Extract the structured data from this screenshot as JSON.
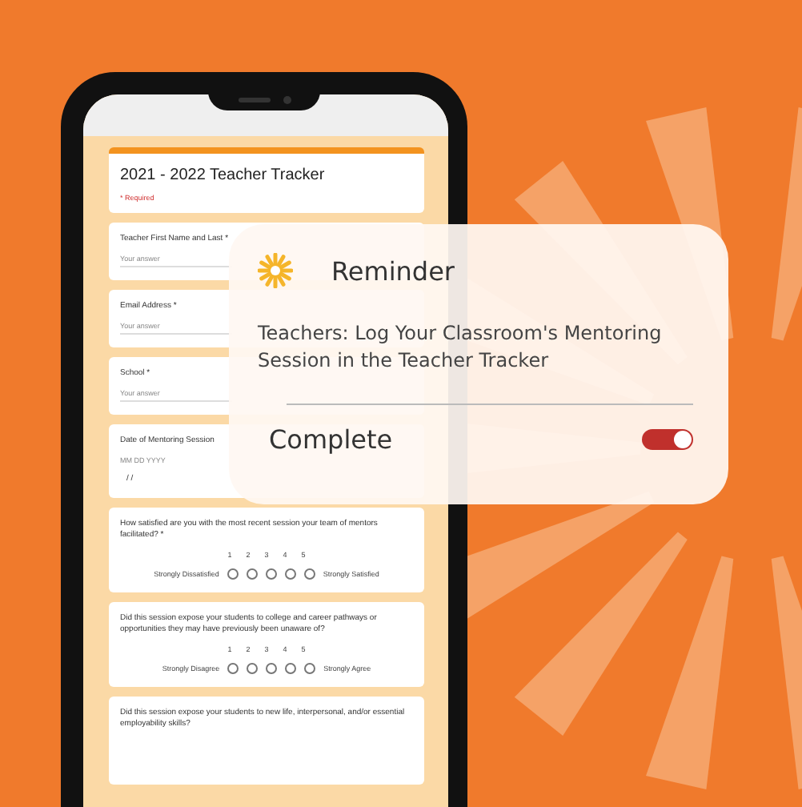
{
  "form": {
    "title": "2021 - 2022 Teacher Tracker",
    "required_note": "* Required",
    "questions": [
      {
        "kind": "text",
        "label": "Teacher First Name and Last *",
        "placeholder": "Your answer"
      },
      {
        "kind": "text",
        "label": "Email Address *",
        "placeholder": "Your answer"
      },
      {
        "kind": "text",
        "label": "School *",
        "placeholder": "Your answer"
      },
      {
        "kind": "date",
        "label": "Date of Mentoring Session",
        "format": "MM DD YYYY",
        "value": "/  /"
      },
      {
        "kind": "scale",
        "label": "How satisfied are you with the most recent session your team of mentors facilitated? *",
        "scale": [
          {
            "label": "1",
            "selected": false
          },
          {
            "label": "2",
            "selected": false
          },
          {
            "label": "3",
            "selected": false
          },
          {
            "label": "4",
            "selected": false
          },
          {
            "label": "5",
            "selected": false
          }
        ],
        "low": "Strongly Dissatisfied",
        "high": "Strongly Satisfied"
      },
      {
        "kind": "scale",
        "label": "Did this session expose your students to college and career pathways or opportunities they may have previously been unaware of?",
        "scale": [
          {
            "label": "1",
            "selected": false
          },
          {
            "label": "2",
            "selected": false
          },
          {
            "label": "3",
            "selected": false
          },
          {
            "label": "4",
            "selected": false
          },
          {
            "label": "5",
            "selected": false
          }
        ],
        "low": "Strongly Disagree",
        "high": "Strongly Agree"
      },
      {
        "kind": "question",
        "label": "Did this session expose your students to new life, interpersonal, and/or essential employability skills?"
      }
    ]
  },
  "notification": {
    "title": "Reminder",
    "message": "Teachers: Log Your Classroom's Mentoring Session in the Teacher Tracker",
    "action": "Complete",
    "on": true
  }
}
